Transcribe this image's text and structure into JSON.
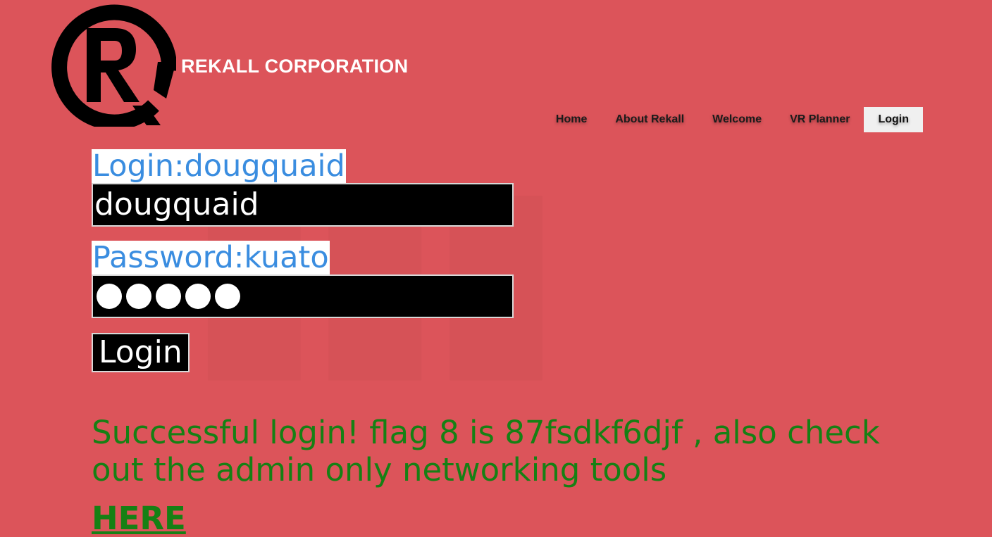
{
  "header": {
    "brand": "REKALL CORPORATION",
    "logo_icon": "rekall-r-logo"
  },
  "nav": {
    "items": [
      {
        "label": "Home"
      },
      {
        "label": "About Rekall"
      },
      {
        "label": "Welcome"
      },
      {
        "label": "VR Planner"
      },
      {
        "label": "Login",
        "active": true
      }
    ]
  },
  "form": {
    "login_label": "Login:dougquaid",
    "login_value": "dougquaid",
    "password_label": "Password:kuato",
    "password_dot_count": 5,
    "submit_label": "Login"
  },
  "result": {
    "message": "Successful login! flag 8 is 87fsdkf6djf , also check out the admin only networking tools",
    "link_text": "HERE"
  },
  "colors": {
    "background": "#dc545a",
    "label_text": "#3a8de0",
    "success_text": "#168014"
  }
}
